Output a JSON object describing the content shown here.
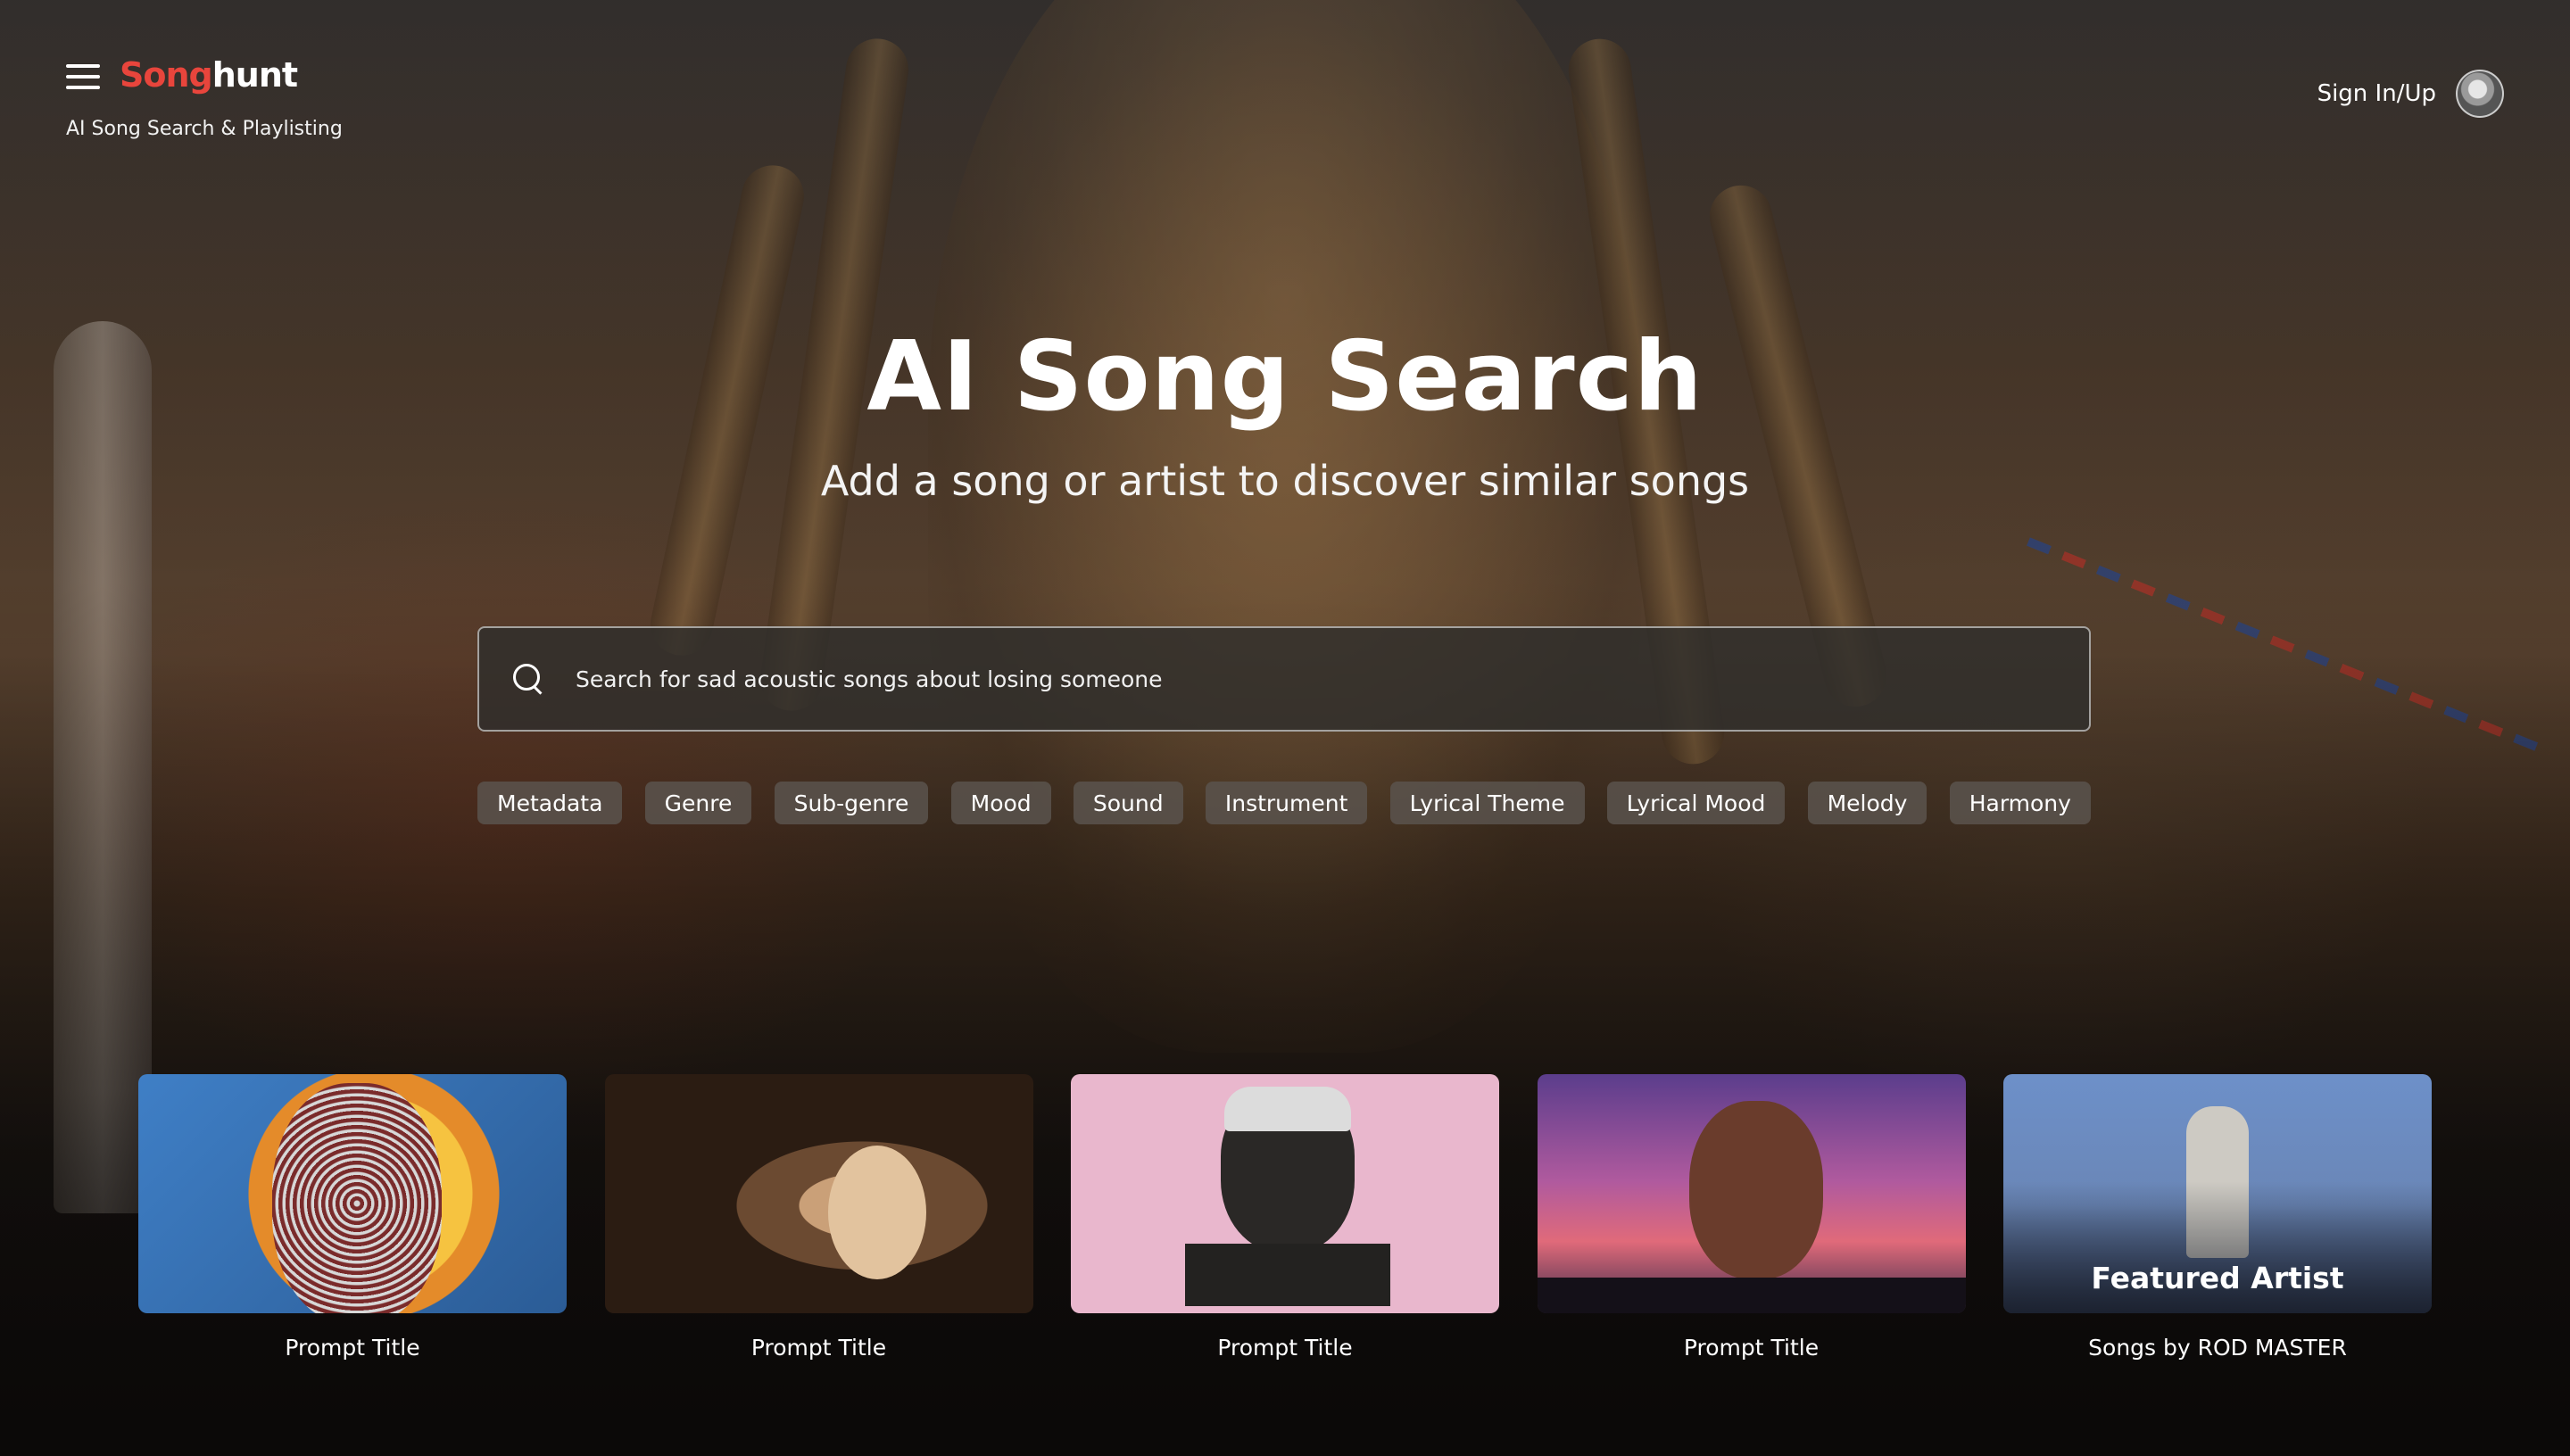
{
  "header": {
    "logo_part1": "Song",
    "logo_part2": "hunt",
    "tagline": "AI Song Search & Playlisting",
    "auth_label": "Sign In/Up"
  },
  "hero": {
    "title": "AI Song Search",
    "subtitle": "Add a song or artist to discover similar songs"
  },
  "search": {
    "placeholder": "Search for sad acoustic songs about losing someone"
  },
  "filters": [
    "Metadata",
    "Genre",
    "Sub-genre",
    "Mood",
    "Sound",
    "Instrument",
    "Lyrical Theme",
    "Lyrical Mood",
    "Melody",
    "Harmony"
  ],
  "cards": [
    {
      "label": "Prompt Title"
    },
    {
      "label": "Prompt Title"
    },
    {
      "label": "Prompt Title"
    },
    {
      "label": "Prompt Title"
    },
    {
      "label": "Songs by ROD MASTER",
      "overlay": "Featured Artist"
    }
  ],
  "colors": {
    "brand_red": "#e8453c",
    "text": "#ffffff"
  },
  "icons": [
    "hamburger-menu-icon",
    "search-icon",
    "avatar"
  ]
}
